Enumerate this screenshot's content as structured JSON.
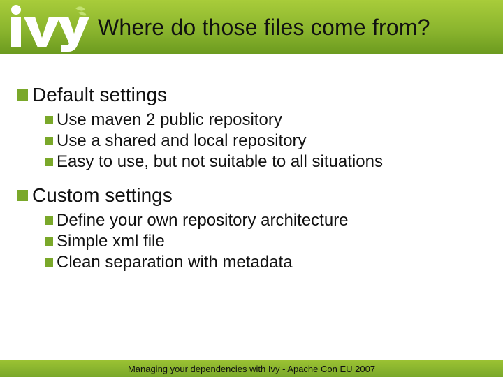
{
  "header": {
    "title": "Where do those files come from?",
    "logo_name": "ivy"
  },
  "sections": [
    {
      "heading": "Default settings",
      "items": [
        "Use maven 2 public repository",
        "Use a shared and local repository",
        "Easy to use, but not suitable to all situations"
      ]
    },
    {
      "heading": "Custom settings",
      "items": [
        "Define your own repository architecture",
        "Simple xml file",
        "Clean separation with metadata"
      ]
    }
  ],
  "footer": {
    "text": "Managing your dependencies with Ivy - Apache Con EU 2007"
  },
  "colors": {
    "accent": "#7aa82a",
    "header_gradient_top": "#a8cc3a",
    "header_gradient_bottom": "#6b9a1f"
  }
}
